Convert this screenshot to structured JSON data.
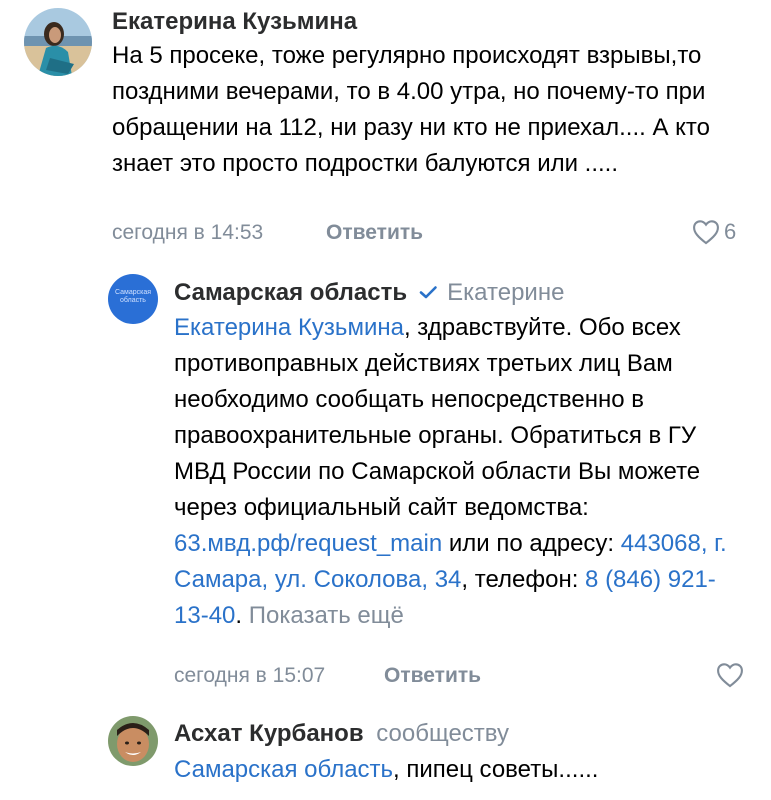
{
  "comments": [
    {
      "author": "Екатерина Кузьмина",
      "text": "На 5 просеке, тоже регулярно происходят взрывы,то поздними вечерами, то в 4.00 утра, но почему-то при обращении на 112, ни разу ни кто не приехал.... А кто знает это просто подростки балуются или .....",
      "time": "сегодня в 14:53",
      "reply_label": "Ответить",
      "likes": "6"
    },
    {
      "author": "Самарская область",
      "reply_to": "Екатерине",
      "mention": "Екатерина Кузьмина",
      "text_1": ", здравствуйте. Обо всех противоправных действиях третьих лиц Вам необходимо сообщать непосредственно в правоохранительные органы. Обратиться в ГУ МВД России по Самарской области Вы можете через официальный сайт ведомства: ",
      "link_site": "63.мвд.рф/request_main",
      "text_2": " или по адресу: ",
      "link_address": "443068, г. Самара, ул. Соколова, 34",
      "text_3": ", телефон: ",
      "link_phone": "8 (846) 921-13-40",
      "text_4": ". ",
      "show_more": "Показать ещё",
      "avatar_text": "Самарская область",
      "time": "сегодня в 15:07",
      "reply_label": "Ответить"
    },
    {
      "author": "Асхат Курбанов",
      "reply_to": "сообществу",
      "mention": "Самарская область",
      "text": ", пипец советы......"
    }
  ],
  "colors": {
    "link": "#2a72c9",
    "muted": "#818c99",
    "verified": "#2a72c9",
    "community_avatar": "#2a6fd6"
  },
  "icons": [
    "heart-icon",
    "verified-icon"
  ]
}
